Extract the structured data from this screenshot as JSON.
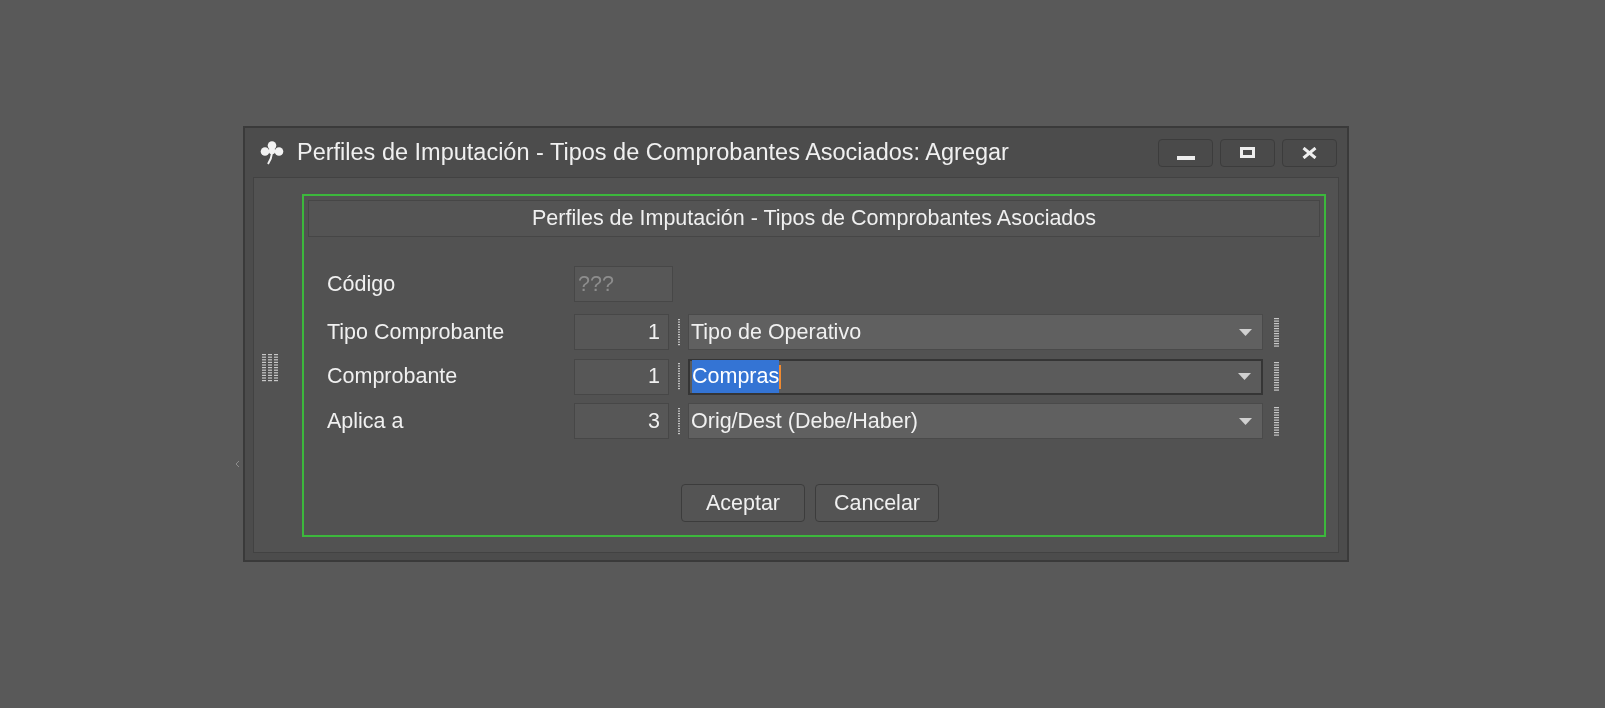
{
  "window": {
    "title": "Perfiles de Imputación - Tipos de Comprobantes Asociados: Agregar"
  },
  "panel": {
    "title": "Perfiles de Imputación - Tipos de Comprobantes Asociados"
  },
  "fields": [
    {
      "kind": "text",
      "label": "Código",
      "placeholder": "???"
    },
    {
      "kind": "lookup",
      "label": "Tipo Comprobante",
      "number": "1",
      "value": "Tipo de Operativo",
      "focused": false
    },
    {
      "kind": "lookup",
      "label": "Comprobante",
      "number": "1",
      "value": "Compras",
      "focused": true
    },
    {
      "kind": "lookup",
      "label": "Aplica a",
      "number": "3",
      "value": "Orig/Dest (Debe/Haber)",
      "focused": false
    }
  ],
  "buttons": [
    {
      "label": "Aceptar"
    },
    {
      "label": "Cancelar"
    }
  ]
}
